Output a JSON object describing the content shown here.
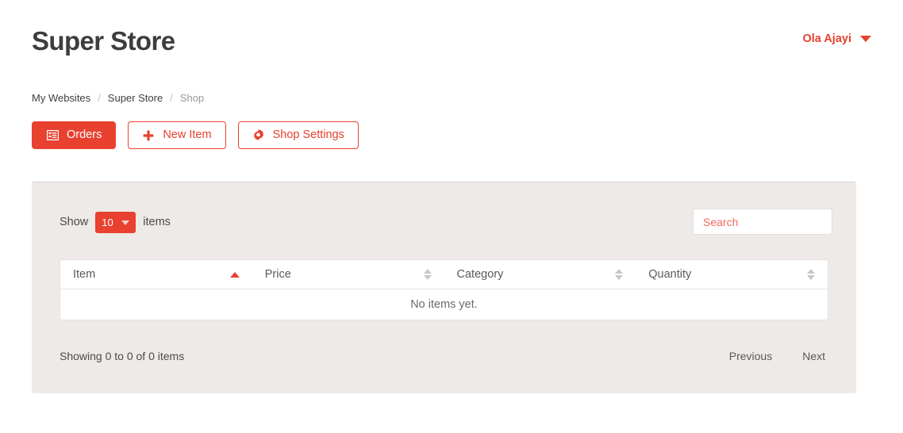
{
  "header": {
    "site_title": "Super Store",
    "user_name": "Ola Ajayi",
    "user_caret_icon": "chevron-down-icon"
  },
  "breadcrumb": {
    "items": [
      {
        "label": "My Websites",
        "current": false
      },
      {
        "label": "Super Store",
        "current": false
      },
      {
        "label": "Shop",
        "current": true
      }
    ],
    "separator": "/"
  },
  "actions": {
    "orders": {
      "label": "Orders",
      "icon": "list-table-icon"
    },
    "new_item": {
      "label": "New Item",
      "icon": "plus-icon"
    },
    "shop_settings": {
      "label": "Shop Settings",
      "icon": "gear-icon"
    }
  },
  "toolbar": {
    "show_label": "Show",
    "items_label": "items",
    "page_length": "10",
    "length_caret_icon": "caret-down-icon",
    "search_placeholder": "Search",
    "search_value": ""
  },
  "table": {
    "columns": [
      {
        "label": "Item",
        "sort": "asc"
      },
      {
        "label": "Price",
        "sort": "none"
      },
      {
        "label": "Category",
        "sort": "none"
      },
      {
        "label": "Quantity",
        "sort": "none"
      }
    ],
    "empty_message": "No items yet."
  },
  "footer": {
    "showing_info": "Showing 0 to 0 of 0 items",
    "previous_label": "Previous",
    "next_label": "Next"
  },
  "colors": {
    "brand_red": "#e8412f",
    "panel_bg": "#eeeae8",
    "text_dark": "#3d3d3d",
    "text_muted": "#9b9896"
  }
}
